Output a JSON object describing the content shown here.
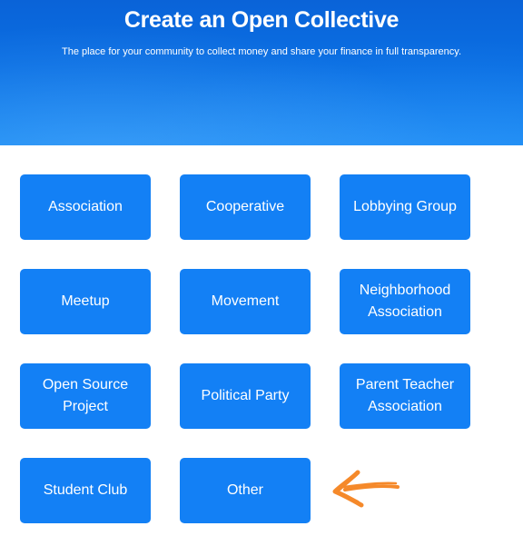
{
  "hero": {
    "title": "Create an Open Collective",
    "subtitle": "The place for your community to collect money and share your finance in full transparency."
  },
  "categories": [
    {
      "label": "Association"
    },
    {
      "label": "Cooperative"
    },
    {
      "label": "Lobbying Group"
    },
    {
      "label": "Meetup"
    },
    {
      "label": "Movement"
    },
    {
      "label": "Neighborhood Association"
    },
    {
      "label": "Open Source Project"
    },
    {
      "label": "Political Party"
    },
    {
      "label": "Parent Teacher Association"
    },
    {
      "label": "Student Club"
    },
    {
      "label": "Other"
    }
  ],
  "colors": {
    "button": "#1380f5",
    "hero": "#0a6fe3",
    "annotation_arrow": "#f5892a"
  },
  "annotation": {
    "icon": "hand-drawn-arrow-left-icon"
  }
}
